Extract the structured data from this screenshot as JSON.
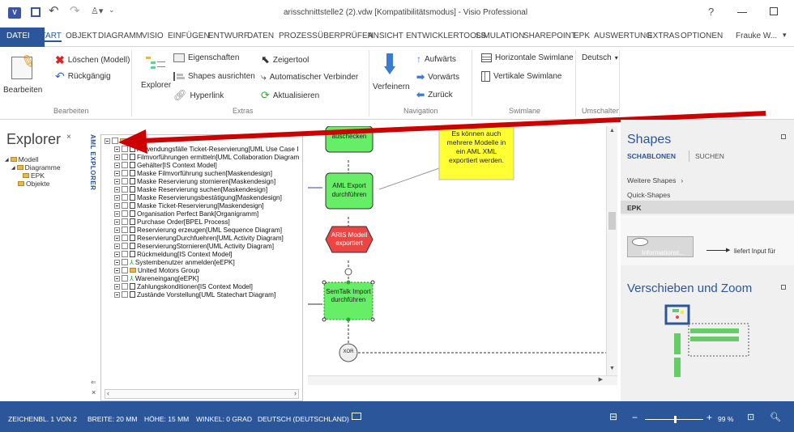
{
  "window": {
    "title": "arisschnittstelle2 (2).vdw  [Kompatibilitätsmodus] - Visio Professional",
    "help": "?",
    "user": "Frauke W...",
    "app_icon": "visio-icon"
  },
  "tabs": [
    "DATEI",
    "START",
    "OBJEKT",
    "DIAGRAMM",
    "VISIO",
    "EINFÜGEN",
    "ENTWURF",
    "DATEN",
    "PROZESS",
    "ÜBERPRÜFEN",
    "ANSICHT",
    "ENTWICKLERTOOLS",
    "SIMULATION",
    "SHAREPOINT",
    "EPK",
    "AUSWERTUNG",
    "EXTRAS",
    "OPTIONEN"
  ],
  "active_tab": "START",
  "ribbon": {
    "bearbeiten": {
      "button": "Bearbeiten",
      "label": "Bearbeiten",
      "delete": "Löschen (Modell)",
      "undo": "Rückgängig"
    },
    "extras": {
      "explorer": "Explorer",
      "props": "Eigenschaften",
      "align": "Shapes ausrichten",
      "hyperlink": "Hyperlink",
      "pointer": "Zeigertool",
      "connector": "Automatischer Verbinder",
      "refresh": "Aktualisieren",
      "label": "Extras"
    },
    "navigation": {
      "refine": "Verfeinern",
      "up": "Aufwärts",
      "forward": "Vorwärts",
      "back": "Zurück",
      "label": "Navigation"
    },
    "swimlane": {
      "horizontal": "Horizontale Swimlane",
      "vertical": "Vertikale Swimlane",
      "label": "Swimlane"
    },
    "umschalten": {
      "lang": "Deutsch",
      "label": "Umschalten"
    }
  },
  "explorer": {
    "title": "Explorer",
    "close": "×",
    "tree": [
      "Modell",
      "Diagramme",
      "EPK",
      "Objekte"
    ]
  },
  "aml_explorer_label": "AML EXPLORER",
  "aml_tree": {
    "root": "Dem",
    "items": [
      "Anwendungsfälle Ticket-Reservierung[UML Use Case I",
      "Filmvorführungen ermitteln[UML Collaboration Diagram",
      "Gehälter[IS Context Model]",
      "Maske Filmvorführung suchen[Maskendesign]",
      "Maske Reservierung stornieren[Maskendesign]",
      "Maske Reservierung suchen[Maskendesign]",
      "Maske Reservierungsbestätigung[Maskendesign]",
      "Maske Ticket-Reservierung[Maskendesign]",
      "Organisation Perfect Bank[Organigramm]",
      "Purchase Order[BPEL Process]",
      "Reservierung erzeugen[UML Sequence Diagram]",
      "ReservierungDurchfuehren[UML Activity Diagram]",
      "ReservierungStornieren[UML Activity Diagram]",
      "Rückmeldung[IS Context Model]",
      "Systembenutzer anmelden[eEPK]",
      "United Motors Group",
      "Wareneingang[eEPK]",
      "Zahlungskonditionen[IS Context Model]",
      "Zustände Vorstellung[UML Statechart Diagram]"
    ],
    "item_icons": [
      "doc",
      "doc",
      "doc",
      "doc",
      "doc",
      "doc",
      "doc",
      "doc",
      "doc",
      "doc",
      "doc",
      "doc",
      "doc",
      "doc",
      "epk",
      "folder",
      "epk",
      "doc",
      "doc"
    ],
    "side_glyphs": [
      "×",
      "⇐"
    ]
  },
  "canvas": {
    "func1": "auschecken",
    "note": "Es können auch mehrere Modelle in ein AML XML exportiert werden.",
    "func2": "AML Export durchführen",
    "event": "ARIS Modell exportiert",
    "func3": "SemTalk Import durchführen",
    "xor": "XOR"
  },
  "shapes": {
    "title": "Shapes",
    "tab_templates": "SCHABLONEN",
    "tab_search": "SUCHEN",
    "more": "Weitere Shapes",
    "quick": "Quick-Shapes",
    "epk": "EPK",
    "info_shape": "Informationst...",
    "supplies": "liefert Input für",
    "pan_zoom": "Verschieben und Zoom"
  },
  "status": {
    "page": "ZEICHENBL. 1 VON 2",
    "width": "BREITE: 20 MM",
    "height": "HÖHE: 15 MM",
    "angle": "WINKEL: 0 GRAD",
    "language": "DEUTSCH (DEUTSCHLAND)",
    "zoom": "99 %",
    "zoom_fraction": 0.99
  },
  "colors": {
    "status_bar": "#2b579a",
    "file_tab": "#2b579a",
    "function_green": "#66ee66",
    "event_red": "#ee4444",
    "note_yellow": "#ffff33",
    "arrow_red": "#cc0000"
  }
}
